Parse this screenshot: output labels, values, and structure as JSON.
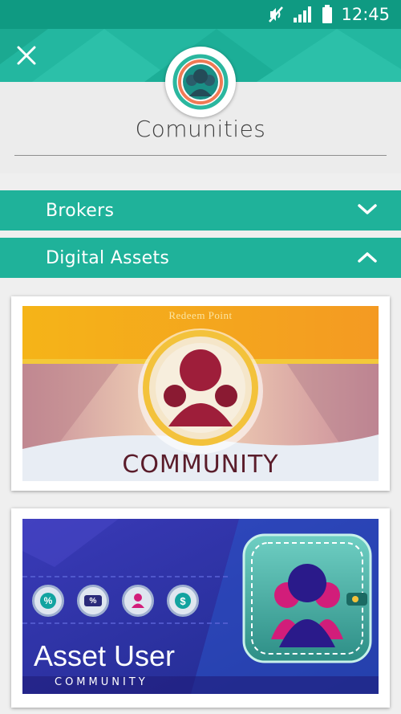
{
  "status_bar": {
    "time": "12:45",
    "icons": [
      "mute-icon",
      "signal-icon",
      "battery-icon"
    ]
  },
  "header": {
    "title": "Comunities",
    "close_icon": "close-icon",
    "logo_icon": "community-logo-icon"
  },
  "sections": [
    {
      "label": "Brokers",
      "icon": "chevron-down-icon",
      "expanded": false
    },
    {
      "label": "Digital Assets",
      "icon": "chevron-up-icon",
      "expanded": true
    }
  ],
  "cards": [
    {
      "subtitle": "Redeem Point",
      "title": "COMMUNITY"
    },
    {
      "title": "Asset User",
      "subtitle": "COMMUNITY",
      "badges": [
        "%",
        "%",
        "",
        "$"
      ]
    }
  ],
  "colors": {
    "status_bar": "#0f9a82",
    "accent": "#1fb29a",
    "header_band": "#23b7a0",
    "background": "#efefef"
  }
}
